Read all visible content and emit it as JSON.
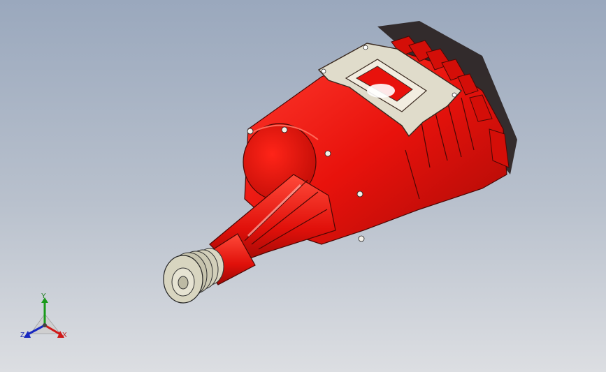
{
  "viewport": {
    "background_top": "#9aa8bd",
    "background_bottom": "#dcdee2"
  },
  "model": {
    "part_color": "#e8120c",
    "part_shade": "#b50c08",
    "pulley_color": "#d9d6c2",
    "edge_color": "#3a0a08"
  },
  "triad": {
    "y_label": "Y",
    "x_label": "X",
    "z_label": "Z",
    "y_color": "#1a9a1a",
    "x_color": "#d01818",
    "z_color": "#1828c0"
  }
}
